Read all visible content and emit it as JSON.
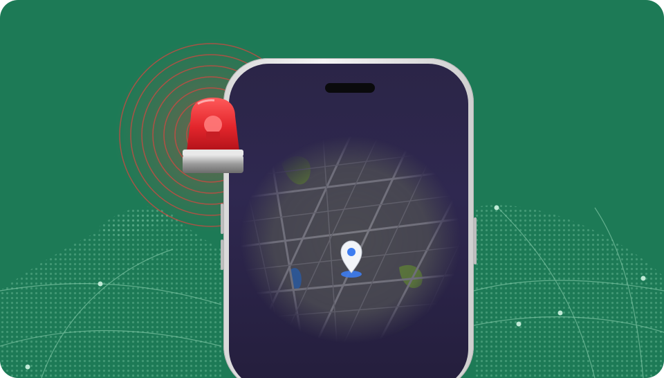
{
  "scene": {
    "description_colors": {
      "background": "#1d7a56",
      "globe_dots": "#5fb08d",
      "alarm_red": "#e3262c",
      "phone_screen": "#2b2547",
      "map_base": "#4a4a52",
      "pin_blue": "#3d7cf0"
    },
    "icons": [
      "siren-icon",
      "location-pin-icon",
      "world-map-icon",
      "phone-icon"
    ]
  }
}
